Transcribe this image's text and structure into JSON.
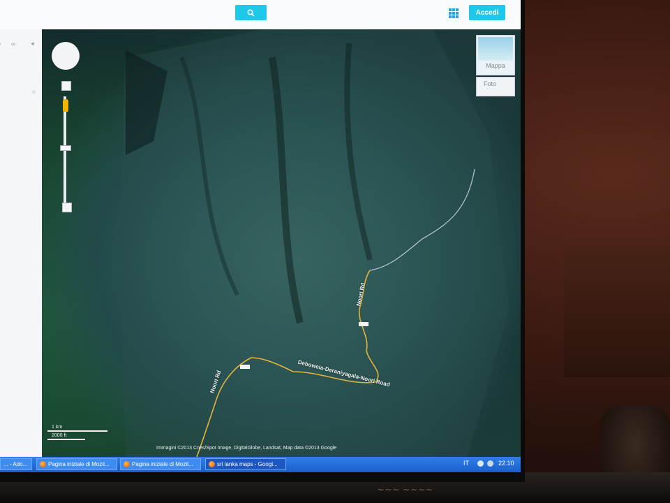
{
  "header": {
    "search_button_icon": "search-icon",
    "apps_icon": "apps-grid-icon",
    "signin_label": "Accedi",
    "accent_color": "#1ec8ea"
  },
  "map": {
    "view": "satellite",
    "maptype_label": "Mappa",
    "photo_label": "Foto",
    "road_labels": [
      "Deboweia-Deraniyagala-Noori Road",
      "Noori Rd",
      "Noori Rd"
    ],
    "scale": {
      "km_label": "1 km",
      "ft_label": "2000 ft"
    },
    "attribution": "Immagini ©2013 Cnes/Spot Image, DigitalGlobe, Landsat, Map data ©2013 Google",
    "road_color": "#e6b43c"
  },
  "taskbar": {
    "tasks": [
      {
        "label": "... - Ado..."
      },
      {
        "label": "Pagina iniziale di Mozil..."
      },
      {
        "label": "Pagina iniziale di Mozil..."
      },
      {
        "label": "sri lanka maps - Googl..."
      }
    ],
    "language": "IT",
    "clock": "22.10"
  }
}
